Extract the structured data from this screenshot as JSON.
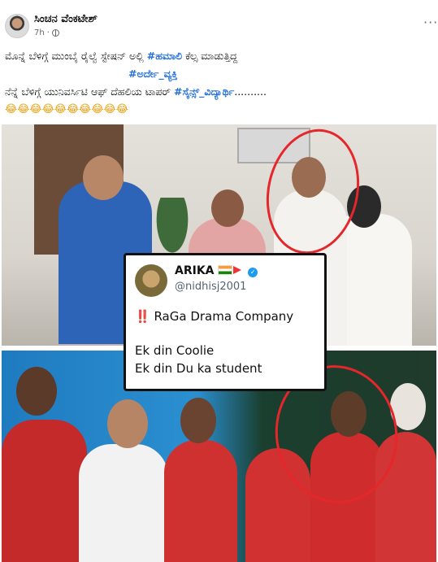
{
  "post": {
    "author": "ಸಿಂಚನ ವೆಂಕಟೇಶ್",
    "time": "7h",
    "more_label": "···",
    "line1_text": "ಮೊನ್ನೆ ಬೆಳಿಗ್ಗೆ ಮುಂಬೈ ರೈಲ್ವೆ ಸ್ಟೇಷನ್ ಅಲ್ಲಿ ",
    "line1_tag": "#ಹಮಾಲಿ",
    "line1_rest": " ಕೆಲ್ಸ ಮಾಡುತ್ತಿದ್ದ",
    "line2_tag": "#ಅರ್ದೇ_ವ್ಯಕ್ತಿ",
    "line3_text": "ನೆನ್ನೆ ಬೆಳಿಗ್ಗೆ ಯುನಿವರ್ಸಿಟಿ ಆಫ್ ದೆಹಲಿಯ ಟಾಪರ್ ",
    "line3_tag": "#ಸೈನ್ಸ್_ವಿದ್ಯಾರ್ಥಿ",
    "line3_rest": "..........",
    "emojis": "😂😂😂😂😂😂😂😂😂😂"
  },
  "tweet": {
    "name": "ARIKA",
    "handle": "@nidhisj2001",
    "bang": "‼️",
    "headline": " RaGa Drama Company",
    "line2": "Ek din Coolie",
    "line3": "Ek din Du ka student"
  },
  "icons": {
    "privacy": "globe-icon",
    "more": "more-options-icon",
    "verified": "verified-badge-icon",
    "flag": "india-flag-icon"
  },
  "colors": {
    "hashtag": "#216fdb",
    "circle": "#e5262a",
    "meta": "#65676b"
  }
}
